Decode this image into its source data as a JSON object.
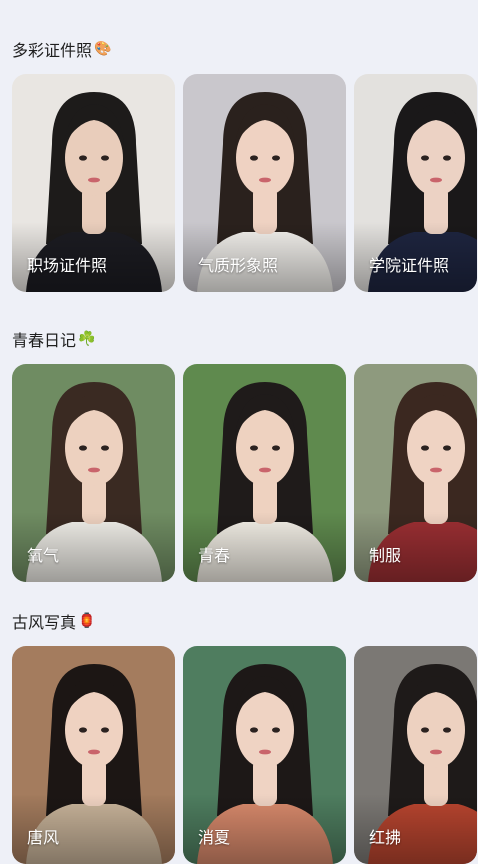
{
  "sections": [
    {
      "title": "多彩证件照",
      "emoji": "🎨",
      "cards": [
        {
          "label": "职场证件照",
          "bg": "#e9e6e2",
          "hair": "#1d1b1a",
          "skin": "#e9cdbb",
          "outfit": "#1c1c22"
        },
        {
          "label": "气质形象照",
          "bg": "#c9c7cc",
          "hair": "#2a211d",
          "skin": "#efd2c2",
          "outfit": "#f2f0ec"
        },
        {
          "label": "学院证件照",
          "bg": "#e3e1de",
          "hair": "#1a1819",
          "skin": "#ecd2c4",
          "outfit": "#1e2540"
        }
      ]
    },
    {
      "title": "青春日记",
      "emoji": "☘️",
      "cards": [
        {
          "label": "氧气",
          "bg": "#6f8c62",
          "hair": "#3a2a22",
          "skin": "#edd1bf",
          "outfit": "#f1efe9"
        },
        {
          "label": "青春",
          "bg": "#5f8a4e",
          "hair": "#1f1b1a",
          "skin": "#eed2c0",
          "outfit": "#f3efe6"
        },
        {
          "label": "制服",
          "bg": "#8e9a7e",
          "hair": "#3b2820",
          "skin": "#efd3c3",
          "outfit": "#9c2f33"
        }
      ]
    },
    {
      "title": "古风写真",
      "emoji": "🏮",
      "cards": [
        {
          "label": "唐风",
          "bg": "#a47c5e",
          "hair": "#1c1614",
          "skin": "#efd2c1",
          "outfit": "#c9b49a"
        },
        {
          "label": "消夏",
          "bg": "#4f7d5f",
          "hair": "#1d1817",
          "skin": "#efd3c3",
          "outfit": "#d98a6c"
        },
        {
          "label": "红拂",
          "bg": "#7b7874",
          "hair": "#1e1a19",
          "skin": "#edd1c0",
          "outfit": "#b9452f"
        }
      ]
    }
  ]
}
